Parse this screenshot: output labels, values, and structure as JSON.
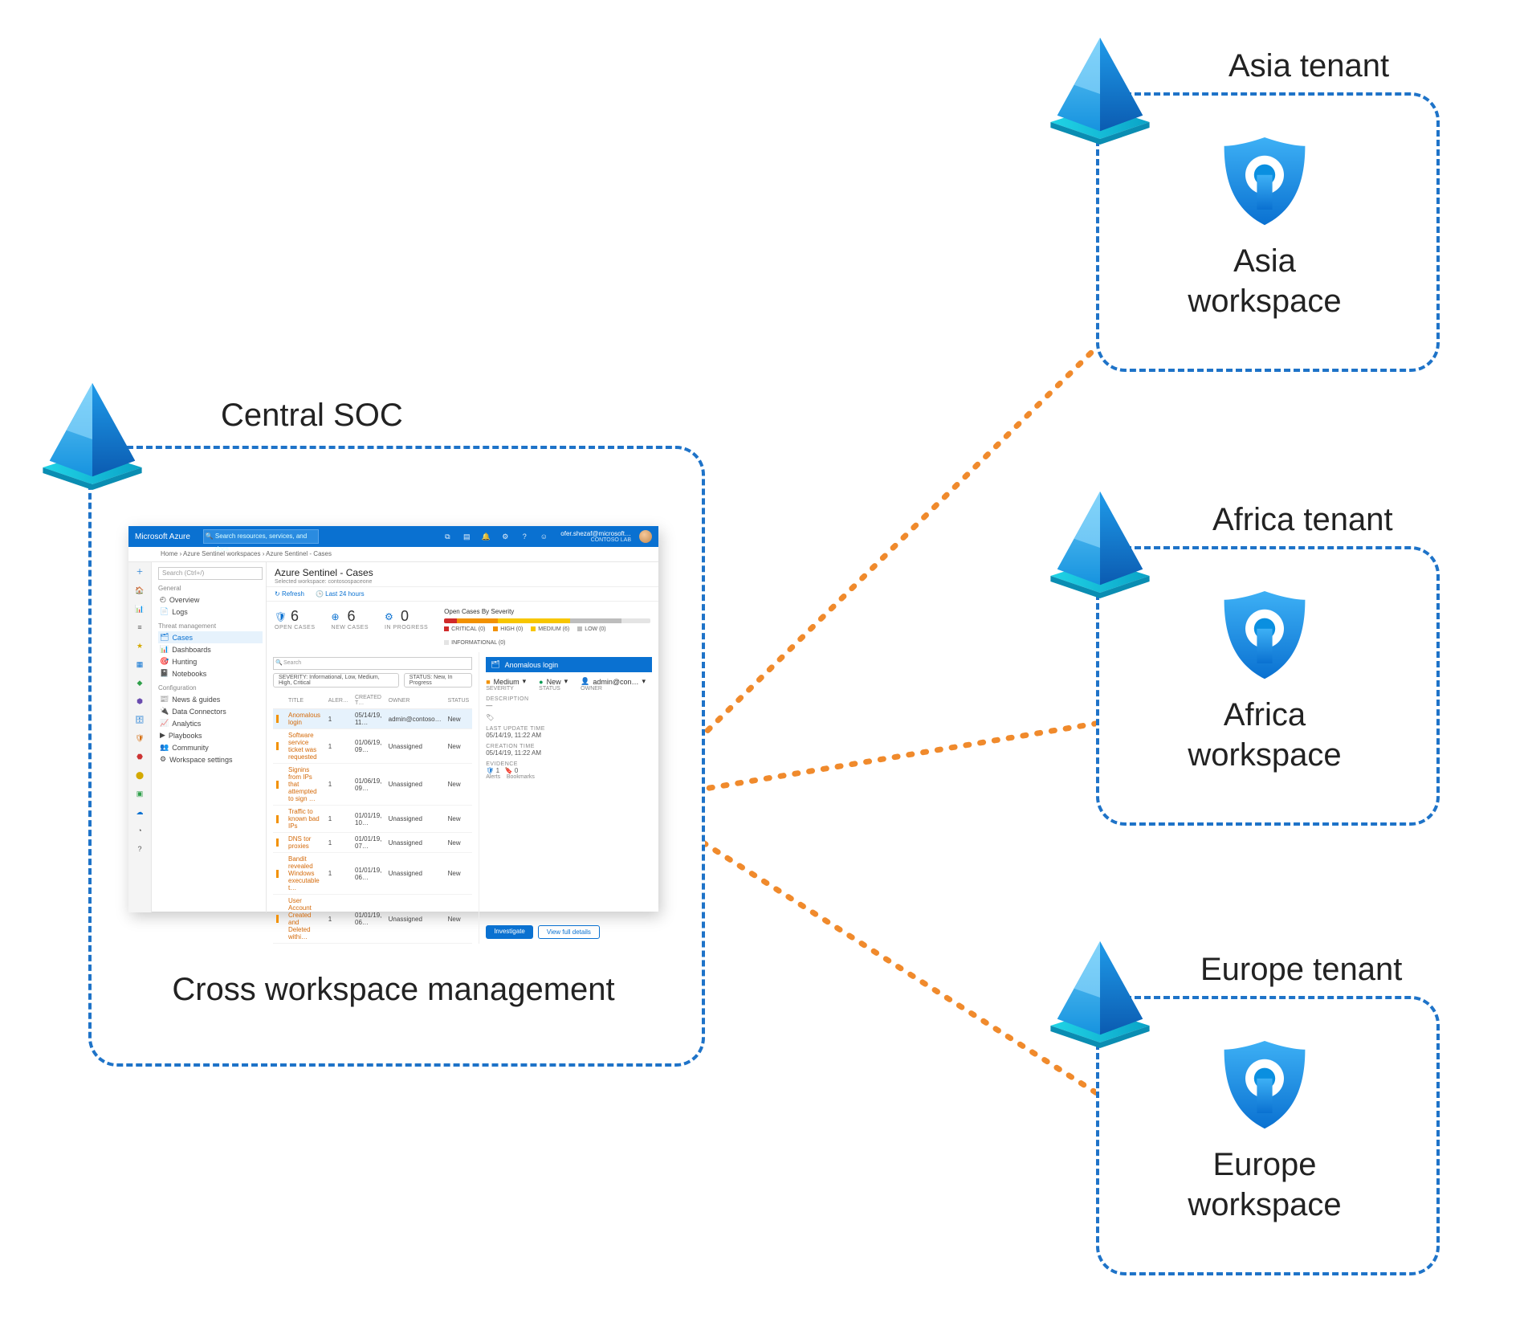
{
  "central": {
    "title": "Central SOC",
    "caption": "Cross workspace management"
  },
  "tenants": [
    {
      "title": "Asia tenant",
      "workspace": "Asia\nworkspace"
    },
    {
      "title": "Africa tenant",
      "workspace": "Africa\nworkspace"
    },
    {
      "title": "Europe tenant",
      "workspace": "Europe\nworkspace"
    }
  ],
  "sentinel": {
    "brand": "Microsoft Azure",
    "search_placeholder": "Search resources, services, and docs",
    "user_name": "ofer.shezaf@microsoft…",
    "user_tenant": "CONTOSO LAB",
    "breadcrumbs": "Home › Azure Sentinel workspaces › Azure Sentinel - Cases",
    "page_title": "Azure Sentinel - Cases",
    "page_subtitle": "Selected workspace: contosospaceone",
    "refresh_label": "Refresh",
    "time_label": "Last 24 hours",
    "nav": {
      "search_placeholder": "Search (Ctrl+/)",
      "sections": [
        {
          "label": "General",
          "items": [
            "Overview",
            "Logs"
          ]
        },
        {
          "label": "Threat management",
          "items": [
            "Cases",
            "Dashboards",
            "Hunting",
            "Notebooks"
          ]
        },
        {
          "label": "Configuration",
          "items": [
            "News & guides",
            "Data Connectors",
            "Analytics",
            "Playbooks",
            "Community",
            "Workspace settings"
          ]
        }
      ],
      "active": "Cases"
    },
    "stats": [
      {
        "value": "6",
        "label": "OPEN CASES"
      },
      {
        "value": "6",
        "label": "NEW CASES"
      },
      {
        "value": "0",
        "label": "IN PROGRESS"
      }
    ],
    "severity": {
      "title": "Open Cases By Severity",
      "legend": [
        "CRITICAL (0)",
        "HIGH (0)",
        "MEDIUM (6)",
        "LOW (0)",
        "INFORMATIONAL (0)"
      ]
    },
    "list": {
      "search_placeholder": "Search",
      "filter_severity": "SEVERITY: Informational, Low, Medium, High, Critical",
      "filter_status": "STATUS: New, In Progress",
      "cols": [
        "TITLE",
        "ALER…",
        "CREATED T…",
        "OWNER",
        "STATUS"
      ],
      "rows": [
        {
          "title": "Anomalous login",
          "alerts": "1",
          "created": "05/14/19, 11…",
          "owner": "admin@contoso…",
          "status": "New"
        },
        {
          "title": "Software service ticket was requested",
          "alerts": "1",
          "created": "01/06/19, 09…",
          "owner": "Unassigned",
          "status": "New"
        },
        {
          "title": "Signins from IPs that attempted to sign …",
          "alerts": "1",
          "created": "01/06/19, 09…",
          "owner": "Unassigned",
          "status": "New"
        },
        {
          "title": "Traffic to known bad IPs",
          "alerts": "1",
          "created": "01/01/19, 10…",
          "owner": "Unassigned",
          "status": "New"
        },
        {
          "title": "DNS tor proxies",
          "alerts": "1",
          "created": "01/01/19, 07…",
          "owner": "Unassigned",
          "status": "New"
        },
        {
          "title": "Bandit revealed Windows executable t…",
          "alerts": "1",
          "created": "01/01/19, 06…",
          "owner": "Unassigned",
          "status": "New"
        },
        {
          "title": "User Account Created and Deleted withi…",
          "alerts": "1",
          "created": "01/01/19, 06…",
          "owner": "Unassigned",
          "status": "New"
        }
      ],
      "selected_index": 0
    },
    "detail": {
      "title": "Anomalous login",
      "severity_label": "Medium",
      "severity_key": "SEVERITY",
      "status_label": "New",
      "status_key": "STATUS",
      "owner_label": "admin@con…",
      "owner_key": "OWNER",
      "description_key": "DESCRIPTION",
      "description_val": "—",
      "last_update_key": "LAST UPDATE TIME",
      "last_update_val": "05/14/19, 11:22 AM",
      "creation_key": "CREATION TIME",
      "creation_val": "05/14/19, 11:22 AM",
      "evidence_key": "EVIDENCE",
      "evidence_alerts": "1",
      "evidence_alerts_label": "Alerts",
      "evidence_bookmarks": "0",
      "evidence_bookmarks_label": "Bookmarks",
      "btn_investigate": "Investigate",
      "btn_view": "View full details"
    }
  }
}
